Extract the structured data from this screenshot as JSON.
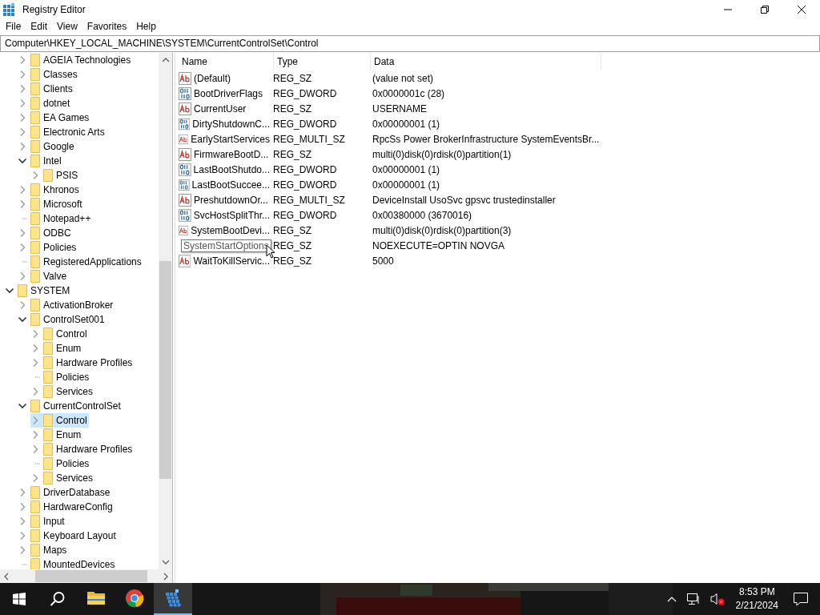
{
  "window": {
    "title": "Registry Editor"
  },
  "menu": [
    "File",
    "Edit",
    "View",
    "Favorites",
    "Help"
  ],
  "address": "Computer\\HKEY_LOCAL_MACHINE\\SYSTEM\\CurrentControlSet\\Control",
  "tree": [
    {
      "children": [
        {
          "children": [
            {
              "label": "AGEIA Technologies",
              "has_subkeys": true,
              "expanded": false,
              "selected": false
            },
            {
              "label": "Classes",
              "has_subkeys": true,
              "expanded": false,
              "selected": false
            },
            {
              "label": "Clients",
              "has_subkeys": true,
              "expanded": false,
              "selected": false
            },
            {
              "label": "dotnet",
              "has_subkeys": true,
              "expanded": false,
              "selected": false
            },
            {
              "label": "EA Games",
              "has_subkeys": true,
              "expanded": false,
              "selected": false
            },
            {
              "label": "Electronic Arts",
              "has_subkeys": true,
              "expanded": false,
              "selected": false
            },
            {
              "label": "Google",
              "has_subkeys": true,
              "expanded": false,
              "selected": false
            },
            {
              "label": "Intel",
              "has_subkeys": true,
              "expanded": true,
              "selected": false,
              "children": [
                {
                  "label": "PSIS",
                  "has_subkeys": true,
                  "expanded": false,
                  "selected": false
                }
              ]
            },
            {
              "label": "Khronos",
              "has_subkeys": true,
              "expanded": false,
              "selected": false
            },
            {
              "label": "Microsoft",
              "has_subkeys": true,
              "expanded": false,
              "selected": false
            },
            {
              "label": "Notepad++",
              "has_subkeys": false,
              "selected": false
            },
            {
              "label": "ODBC",
              "has_subkeys": true,
              "expanded": false,
              "selected": false
            },
            {
              "label": "Policies",
              "has_subkeys": true,
              "expanded": false,
              "selected": false
            },
            {
              "label": "RegisteredApplications",
              "has_subkeys": false,
              "selected": false
            },
            {
              "label": "Valve",
              "has_subkeys": true,
              "expanded": false,
              "selected": false
            }
          ]
        }
      ]
    },
    {
      "label": "SYSTEM",
      "has_subkeys": true,
      "expanded": true,
      "selected": false,
      "children": [
        {
          "label": "ActivationBroker",
          "has_subkeys": true,
          "expanded": false,
          "selected": false
        },
        {
          "label": "ControlSet001",
          "has_subkeys": true,
          "expanded": true,
          "selected": false,
          "children": [
            {
              "label": "Control",
              "has_subkeys": true,
              "expanded": false,
              "selected": false
            },
            {
              "label": "Enum",
              "has_subkeys": true,
              "expanded": false,
              "selected": false
            },
            {
              "label": "Hardware Profiles",
              "has_subkeys": true,
              "expanded": false,
              "selected": false
            },
            {
              "label": "Policies",
              "has_subkeys": false,
              "selected": false
            },
            {
              "label": "Services",
              "has_subkeys": true,
              "expanded": false,
              "selected": false
            }
          ]
        },
        {
          "label": "CurrentControlSet",
          "has_subkeys": true,
          "expanded": true,
          "selected": false,
          "children": [
            {
              "label": "Control",
              "has_subkeys": true,
              "expanded": false,
              "selected": true
            },
            {
              "label": "Enum",
              "has_subkeys": true,
              "expanded": false,
              "selected": false
            },
            {
              "label": "Hardware Profiles",
              "has_subkeys": true,
              "expanded": false,
              "selected": false
            },
            {
              "label": "Policies",
              "has_subkeys": false,
              "selected": false
            },
            {
              "label": "Services",
              "has_subkeys": true,
              "expanded": false,
              "selected": false
            }
          ]
        },
        {
          "label": "DriverDatabase",
          "has_subkeys": true,
          "expanded": false,
          "selected": false
        },
        {
          "label": "HardwareConfig",
          "has_subkeys": true,
          "expanded": false,
          "selected": false
        },
        {
          "label": "Input",
          "has_subkeys": true,
          "expanded": false,
          "selected": false
        },
        {
          "label": "Keyboard Layout",
          "has_subkeys": true,
          "expanded": false,
          "selected": false
        },
        {
          "label": "Maps",
          "has_subkeys": true,
          "expanded": false,
          "selected": false
        },
        {
          "label": "MountedDevices",
          "has_subkeys": false,
          "selected": false
        }
      ]
    }
  ],
  "values": {
    "columns": [
      "Name",
      "Type",
      "Data"
    ],
    "rows": [
      {
        "kind": "string",
        "name": "(Default)",
        "type": "REG_SZ",
        "data": "(value not set)"
      },
      {
        "kind": "binary",
        "name": "BootDriverFlags",
        "type": "REG_DWORD",
        "data": "0x0000001c (28)"
      },
      {
        "kind": "string",
        "name": "CurrentUser",
        "type": "REG_SZ",
        "data": "USERNAME"
      },
      {
        "kind": "binary",
        "name": "DirtyShutdownC...",
        "type": "REG_DWORD",
        "data": "0x00000001 (1)"
      },
      {
        "kind": "string",
        "name": "EarlyStartServices",
        "type": "REG_MULTI_SZ",
        "data": "RpcSs Power BrokerInfrastructure SystemEventsBr..."
      },
      {
        "kind": "string",
        "name": "FirmwareBootD...",
        "type": "REG_SZ",
        "data": "multi(0)disk(0)rdisk(0)partition(1)"
      },
      {
        "kind": "binary",
        "name": "LastBootShutdo...",
        "type": "REG_DWORD",
        "data": "0x00000001 (1)"
      },
      {
        "kind": "binary",
        "name": "LastBootSuccee...",
        "type": "REG_DWORD",
        "data": "0x00000001 (1)"
      },
      {
        "kind": "string",
        "name": "PreshutdownOr...",
        "type": "REG_MULTI_SZ",
        "data": "DeviceInstall UsoSvc gpsvc trustedinstaller"
      },
      {
        "kind": "binary",
        "name": "SvcHostSplitThr...",
        "type": "REG_DWORD",
        "data": "0x00380000 (3670016)"
      },
      {
        "kind": "string",
        "name": "SystemBootDevi...",
        "type": "REG_SZ",
        "data": "multi(0)disk(0)rdisk(0)partition(3)"
      },
      {
        "kind": "string",
        "tooltip": "SystemStartOptions",
        "type": "REG_SZ",
        "data": " NOEXECUTE=OPTIN  NOVGA"
      },
      {
        "kind": "string",
        "name": "WaitToKillServic...",
        "type": "REG_SZ",
        "data": "5000"
      }
    ]
  },
  "taskbar": {
    "apps": [
      {
        "kind": "explorer",
        "active": false
      },
      {
        "kind": "chrome",
        "active": false
      },
      {
        "kind": "regedit",
        "active": true
      }
    ],
    "time": "8:53 PM",
    "date": "2/21/2024"
  }
}
